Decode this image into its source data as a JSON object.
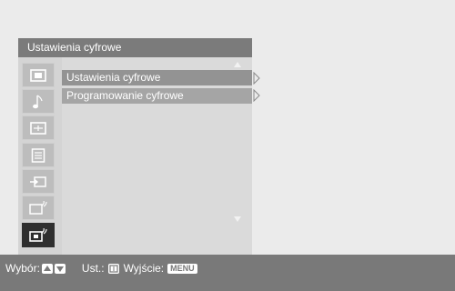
{
  "panel": {
    "title": "Ustawienia cyfrowe",
    "icons": [
      {
        "name": "picture-icon",
        "selected": false
      },
      {
        "name": "sound-note-icon",
        "selected": false
      },
      {
        "name": "screen-icon",
        "selected": false
      },
      {
        "name": "features-list-icon",
        "selected": false
      },
      {
        "name": "input-icon",
        "selected": false
      },
      {
        "name": "analog-settings-icon",
        "selected": false
      },
      {
        "name": "digital-settings-icon",
        "selected": true
      }
    ],
    "menu_items": [
      {
        "label": "Ustawienia cyfrowe",
        "focused": true
      },
      {
        "label": "Programowanie cyfrowe",
        "focused": false
      }
    ]
  },
  "bottom_bar": {
    "select_label": "Wybór:",
    "set_label": "Ust.:",
    "exit_label": "Wyjście:",
    "menu_key": "MENU"
  },
  "colors": {
    "title_bar": "#7b7b7b",
    "panel_bg": "#d4d4d4",
    "menu_item_bg": "#a5a5a5",
    "selected_icon_bg": "#2f2f2f",
    "bottom_bar": "#797979",
    "page_bg": "#ebebeb"
  }
}
